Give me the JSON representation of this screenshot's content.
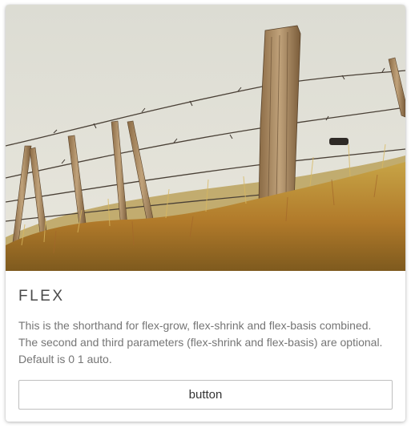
{
  "card": {
    "image_alt": "Fence posts with barbed wire over tall grass",
    "title": "FLEX",
    "text": "This is the shorthand for flex-grow, flex-shrink and flex-basis combined. The second and third parameters (flex-shrink and flex-basis) are optional. Default is 0 1 auto.",
    "button_label": "button"
  },
  "colors": {
    "sky": "#e2e1d8",
    "grass": "#c9a23a",
    "wood": "#a88a62"
  }
}
